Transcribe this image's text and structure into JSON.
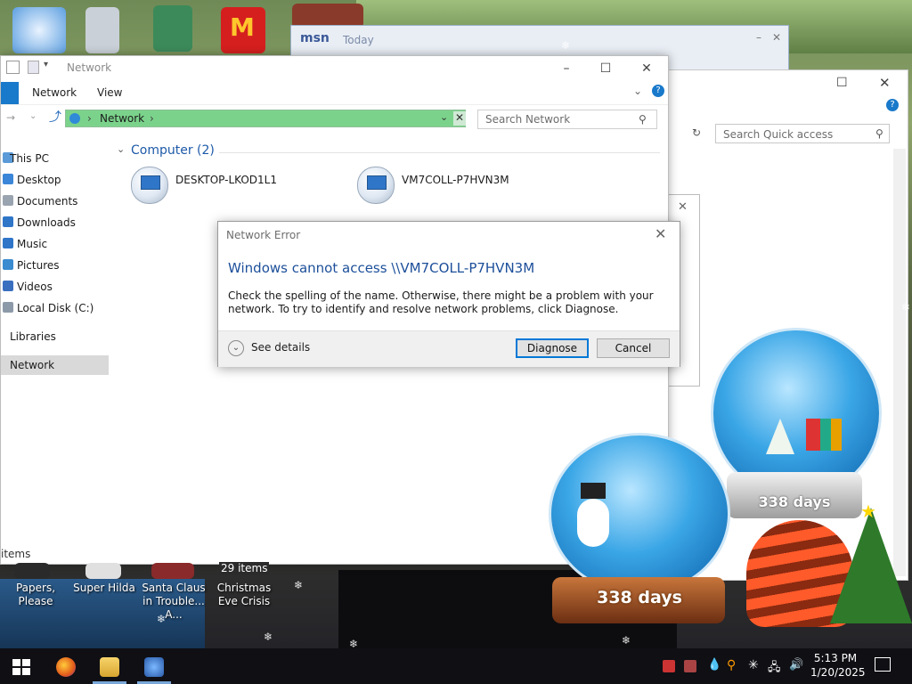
{
  "msn": {
    "logo": "msn",
    "title": "Today"
  },
  "back_explorer": {
    "search_placeholder": "Search Quick access"
  },
  "explorer": {
    "title": "Network",
    "ribbon": {
      "view_tab": "View",
      "network_tab": "Network"
    },
    "address": {
      "crumb": "Network"
    },
    "search_placeholder": "Search Network",
    "nav": [
      {
        "label": "This PC"
      },
      {
        "label": "Desktop"
      },
      {
        "label": "Documents"
      },
      {
        "label": "Downloads"
      },
      {
        "label": "Music"
      },
      {
        "label": "Pictures"
      },
      {
        "label": "Videos"
      },
      {
        "label": "Local Disk (C:)"
      },
      {
        "label": "Libraries"
      },
      {
        "label": "Network"
      }
    ],
    "group_header": "Computer (2)",
    "computers": [
      {
        "name": "DESKTOP-LKOD1L1"
      },
      {
        "name": "VM7COLL-P7HVN3M"
      }
    ],
    "status": "items",
    "status_back": "29 items"
  },
  "dialog": {
    "title": "Network Error",
    "heading": "Windows cannot access \\\\VM7COLL-P7HVN3M",
    "message": "Check the spelling of the name. Otherwise, there might be a problem with your network. To try to identify and resolve network problems, click Diagnose.",
    "see_details": "See details",
    "diagnose": "Diagnose",
    "cancel": "Cancel"
  },
  "desktop_labels": [
    {
      "label": "Papers, Please"
    },
    {
      "label": "Super Hilda"
    },
    {
      "label": "Santa Claus in Trouble... A..."
    },
    {
      "label": "Christmas Eve Crisis"
    }
  ],
  "widgets": {
    "globe1_days": "338 days",
    "globe2_days": "338 days"
  },
  "taskbar": {
    "time": "5:13 PM",
    "date": "1/20/2025"
  },
  "colors": {
    "accent": "#0078d7",
    "address_bar": "#7bd38b",
    "heading": "#1c4f9a"
  }
}
